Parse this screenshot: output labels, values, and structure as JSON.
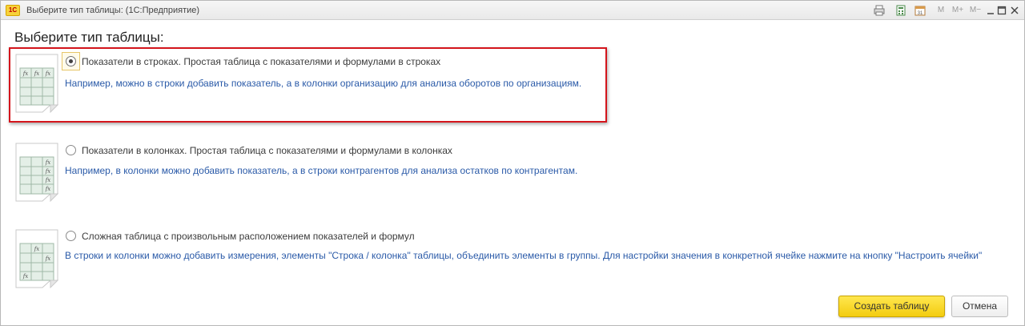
{
  "window": {
    "title": "Выберите тип таблицы: (1С:Предприятие)",
    "logo_text": "1С",
    "toolbar": {
      "m_label": "M",
      "mplus_label": "M+",
      "mminus_label": "M−",
      "icons": [
        "print-icon",
        "calculator-icon",
        "calendar-icon",
        "minimize-icon",
        "maximize-icon",
        "close-icon"
      ]
    }
  },
  "heading": "Выберите тип таблицы:",
  "options": [
    {
      "label": "Показатели в строках. Простая таблица с показателями и формулами в строках",
      "description": "Например, можно в строки добавить показатель, а в колонки организацию для анализа оборотов по организациям.",
      "checked": true,
      "thumb_icon": "rows-table-icon"
    },
    {
      "label": "Показатели в колонках. Простая таблица с показателями и формулами в колонках",
      "description": "Например, в колонки можно добавить показатель, а в строки контрагентов для анализа остатков по контрагентам.",
      "checked": false,
      "thumb_icon": "columns-table-icon"
    },
    {
      "label": "Сложная таблица с произвольным расположением показателей и формул",
      "description": "В строки и колонки можно добавить измерения, элементы \"Строка / колонка\" таблицы, объединить элементы в группы. Для настройки значения в конкретной ячейке нажмите на кнопку \"Настроить ячейки\"",
      "checked": false,
      "thumb_icon": "complex-table-icon"
    }
  ],
  "thumb_fx": "fx",
  "buttons": {
    "create": "Создать таблицу",
    "cancel": "Отмена"
  },
  "colors": {
    "accent_yellow": "#f3cc0f",
    "link_blue": "#2a5aa8",
    "highlight_red": "#d4151c"
  }
}
